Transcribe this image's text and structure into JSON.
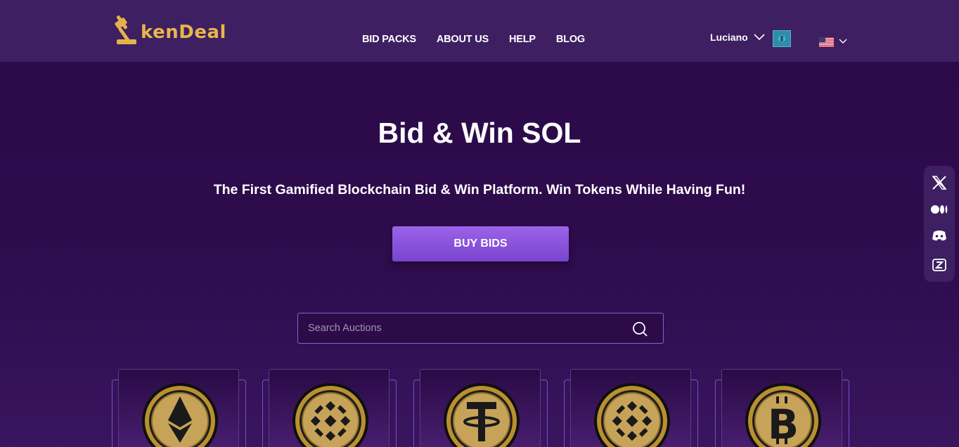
{
  "brand": {
    "name": "TokenDeal",
    "logo_text": "kenDeal",
    "color": "#e8b54a"
  },
  "nav": {
    "items": [
      {
        "label": "BID PACKS"
      },
      {
        "label": "ABOUT US"
      },
      {
        "label": "HELP"
      },
      {
        "label": "BLOG"
      }
    ]
  },
  "user": {
    "name": "Luciano"
  },
  "language": {
    "flag": "us-flag-icon"
  },
  "hero": {
    "title": "Bid & Win SOL",
    "subtitle": "The First Gamified Blockchain Bid & Win Platform. Win Tokens While Having Fun!",
    "cta_label": "BUY BIDS"
  },
  "search": {
    "placeholder": "Search Auctions",
    "value": ""
  },
  "social": [
    "x-icon",
    "medium-icon",
    "discord-icon",
    "zealy-icon"
  ],
  "auctions": [
    {
      "coin": "ethereum-coin-icon"
    },
    {
      "coin": "binance-coin-icon"
    },
    {
      "coin": "tether-coin-icon"
    },
    {
      "coin": "binance-coin-icon"
    },
    {
      "coin": "bitcoin-coin-icon"
    }
  ],
  "colors": {
    "accent": "#8a55dc",
    "header_bg": "#3d1f62",
    "page_bg": "#2c0a49",
    "gold": "#c9a04a"
  }
}
